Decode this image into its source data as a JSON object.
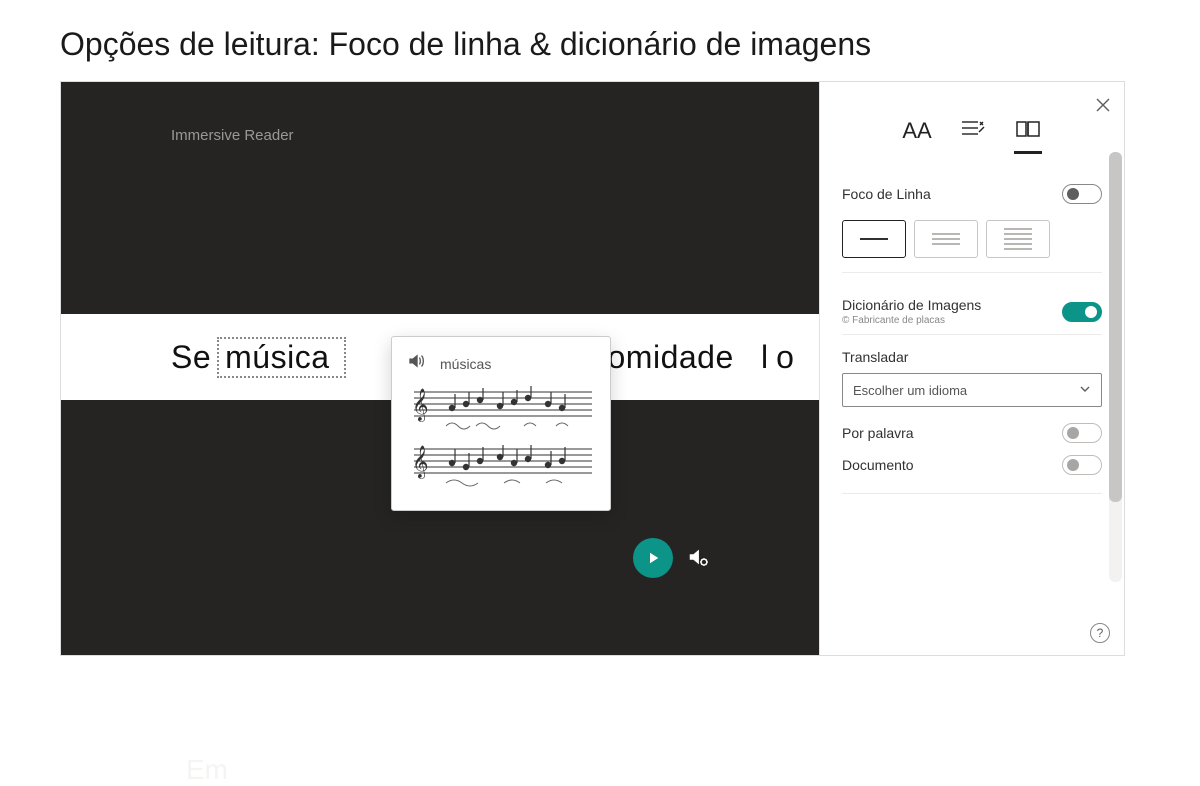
{
  "page": {
    "title": "Opções de leitura: Foco de linha &amp; dicionário de imagens"
  },
  "reader": {
    "app_label": "Immersive Reader",
    "words": {
      "w1": "Se",
      "w2": "música",
      "w3": "comidade",
      "w4": "lo",
      "dim": "Em"
    },
    "popup_label": "músicas"
  },
  "sidebar": {
    "tabs": {
      "text": "AA"
    },
    "line_focus": {
      "label": "Foco de Linha",
      "on": false
    },
    "picture_dict": {
      "label": "Dicionário de Imagens",
      "hint": "© Fabricante de placas",
      "on": true
    },
    "translate": {
      "label": "Transladar",
      "placeholder": "Escolher um idioma"
    },
    "by_word": {
      "label": "Por palavra",
      "on": false
    },
    "document": {
      "label": "Documento",
      "on": false
    }
  }
}
